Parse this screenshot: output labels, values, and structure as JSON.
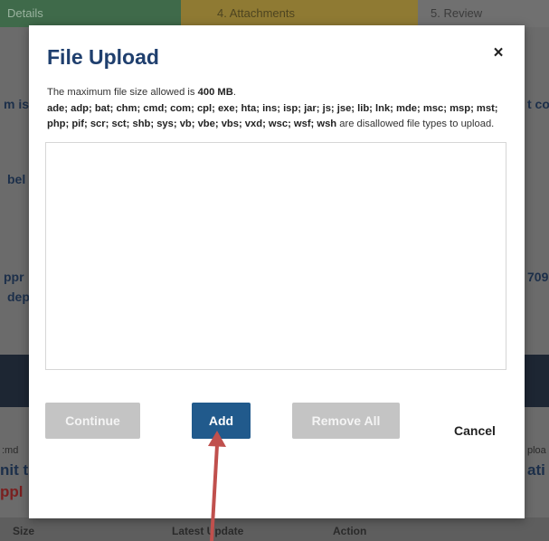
{
  "steps": [
    "Details",
    "4. Attachments",
    "5. Review"
  ],
  "background": {
    "left_fragments": [
      "m is",
      "bel",
      "ppr",
      "dep",
      "nit t",
      "ppl"
    ],
    "right_fragments": [
      "t co",
      "709",
      "ploa",
      "ati"
    ],
    "left_small": ":md"
  },
  "table_header": {
    "size": "Size",
    "latest_update": "Latest Update",
    "action": "Action"
  },
  "modal": {
    "title": "File Upload",
    "close_symbol": "×",
    "max_size_prefix": "The maximum file size allowed is",
    "max_size_value": "400 MB",
    "max_size_suffix": ".",
    "disallowed_types": "ade; adp; bat; chm; cmd; com; cpl; exe; hta; ins; isp; jar; js; jse; lib; lnk; mde; msc; msp; mst; php; pif; scr; sct; shb; sys; vb; vbe; vbs; vxd; wsc; wsf; wsh",
    "disallowed_suffix": "are disallowed file types to upload.",
    "buttons": {
      "continue": "Continue",
      "add": "Add",
      "remove_all": "Remove All",
      "cancel": "Cancel"
    }
  },
  "colors": {
    "title": "#1f3f6e",
    "add_button": "#215a8c",
    "disabled_button": "#c4c4c4",
    "arrow": "#c0504d"
  }
}
